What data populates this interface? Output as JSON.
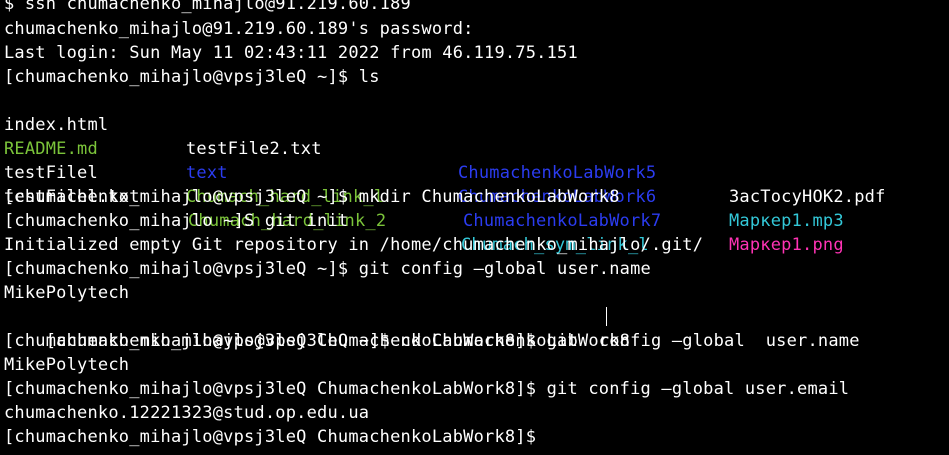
{
  "colors": {
    "background": "#000000",
    "text": "#ffffff",
    "green": "#7bc43a",
    "blue": "#2b3cf0",
    "cyan": "#33c8d8",
    "magenta": "#ff33b5"
  },
  "lines": [
    {
      "segments": [
        {
          "text": "$ ssh chumachenko_mihajlo@91.219.60.189",
          "color": "#ffffff"
        }
      ]
    },
    {
      "segments": [
        {
          "text": "chumachenko_mihajlo@91.219.60.189's password:",
          "color": "#ffffff"
        }
      ]
    },
    {
      "segments": [
        {
          "text": "Last login: Sun May 11 02:43:11 2022 from 46.119.75.151",
          "color": "#ffffff"
        }
      ]
    },
    {
      "segments": [
        {
          "text": "[chumachenko_mihajlo@vpsj3leQ ~]$ ls",
          "color": "#ffffff"
        }
      ]
    },
    {
      "type": "ls-row",
      "cells": [
        {
          "text": "index.html",
          "color": "#ffffff"
        },
        {
          "text": "testFile2.txt",
          "color": "#ffffff"
        },
        {
          "text": "ChumachenkoLabWork5",
          "color": "#2b3cf0"
        },
        {
          "text": "ЗасТосуНОК2.pdf",
          "color": "#ffffff"
        }
      ]
    },
    {
      "type": "ls-row",
      "cells": [
        {
          "text": "README.md",
          "color": "#7bc43a"
        },
        {
          "text": "text",
          "color": "#2b3cf0"
        },
        {
          "text": "ChumachenkoLabWork6",
          "color": "#2b3cf0"
        },
        {
          "text": "Маркер1.mp3",
          "color": "#33c8d8"
        }
      ]
    },
    {
      "type": "ls-row",
      "cells": [
        {
          "text": "testFilel",
          "color": "#ffffff"
        },
        {
          "text": "Chumach_hard_link_l",
          "color": "#7bc43a"
        },
        {
          "text": "ChumachenkoLabWork7",
          "color": "#2b3cf0"
        },
        {
          "text": "Маркер1.png",
          "color": "#ff33b5"
        }
      ]
    },
    {
      "type": "ls-row",
      "cells": [
        {
          "text": "testFilel.txt",
          "color": "#ffffff"
        },
        {
          "text": "Chumach_hard_link_2",
          "color": "#7bc43a"
        },
        {
          "text": "Chumach_sym_link_l",
          "color": "#33c8d8"
        },
        {
          "text": "",
          "color": "#ffffff"
        }
      ]
    },
    {
      "segments": [
        {
          "text": "[chumachenko_mihajlo@vpsj3leQ ~]$ mkdir ChumachenkoLabWork8",
          "color": "#ffffff"
        }
      ]
    },
    {
      "segments": [
        {
          "text": "[chumachenko_mihajlo ~]S git init",
          "color": "#ffffff"
        }
      ]
    },
    {
      "segments": [
        {
          "text": "Initialized empty Git repository in /home/chumachenko_mihajlo/.git/",
          "color": "#ffffff"
        }
      ]
    },
    {
      "segments": [
        {
          "text": "[chumachenko_mihajlo@vpsj3leQ ~]$ git config —global user.name",
          "color": "#ffffff"
        }
      ]
    },
    {
      "segments": [
        {
          "text": "MikePolytech",
          "color": "#ffffff"
        }
      ]
    },
    {
      "segments": [
        {
          "text": "[chumachenko_mihajlo@vpsj3leQ ~]$ cd ChumachenkoLabWork8",
          "color": "#ffffff"
        }
      ]
    },
    {
      "segments": [
        {
          "text": "[chumachenko_mihajlo@vpsj3leQ ChumachenkoLabWork8]$ git  config —global  user.name",
          "color": "#ffffff"
        }
      ]
    },
    {
      "segments": [
        {
          "text": "MikePolytech",
          "color": "#ffffff"
        }
      ]
    },
    {
      "segments": [
        {
          "text": "[chumachenko_mihajlo@vpsj3leQ ChumachenkoLabWork8]$ git config —global user.email",
          "color": "#ffffff"
        }
      ]
    },
    {
      "segments": [
        {
          "text": "chumachenko.12221323@stud.op.edu.ua",
          "color": "#ffffff"
        }
      ]
    },
    {
      "segments": [
        {
          "text": "[chumachenko_mihajlo@vpsj3leQ ChumachenkoLabWork8]$",
          "color": "#ffffff"
        }
      ]
    }
  ]
}
